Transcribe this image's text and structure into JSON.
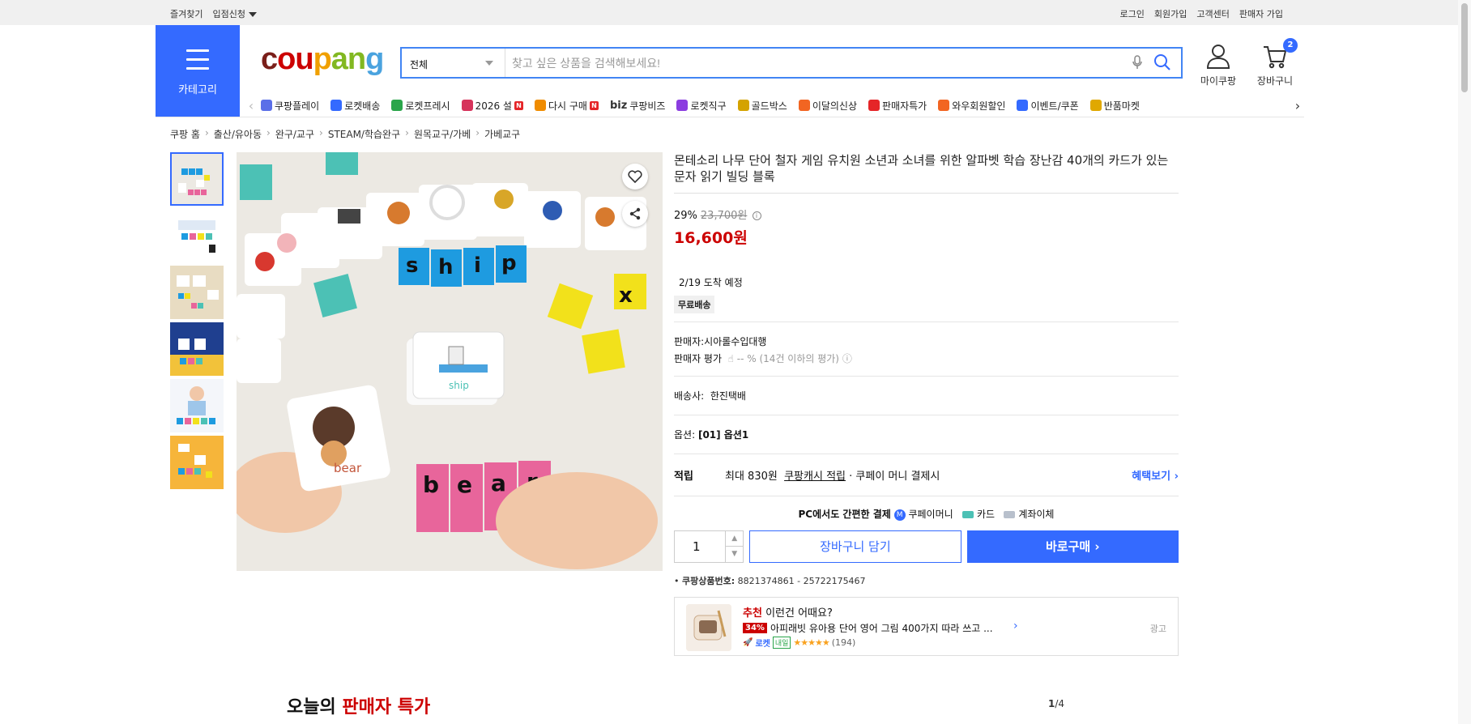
{
  "topbar": {
    "bookmark": "즐겨찾기",
    "vendor_apply": "입점신청",
    "login": "로그인",
    "signup": "회원가입",
    "cs": "고객센터",
    "seller_signup": "판매자 가입"
  },
  "header": {
    "category_label": "카테고리",
    "logo_parts": [
      "c",
      "ou",
      "p",
      "an",
      "g"
    ],
    "search_category": "전체",
    "search_placeholder": "찾고 싶은 상품을 검색해보세요!",
    "mycoupang": "마이쿠팡",
    "cart_label": "장바구니",
    "cart_count": "2"
  },
  "gnb": [
    {
      "label": "쿠팡플레이",
      "icon": "play-icon",
      "color": "#5b6fe8"
    },
    {
      "label": "로켓배송",
      "icon": "rocket-icon",
      "color": "#346aff"
    },
    {
      "label": "로켓프레시",
      "icon": "rocket-fresh-icon",
      "color": "#2aa54a"
    },
    {
      "label": "2026 설",
      "icon": "gift-icon",
      "color": "#d6335b",
      "badge": "N"
    },
    {
      "label": "다시 구매",
      "icon": "rebuy-icon",
      "color": "#f08c00",
      "badge": "N"
    },
    {
      "label": "쿠팡비즈",
      "icon": "biz-icon",
      "color": "#333",
      "prefix": "biz"
    },
    {
      "label": "로켓직구",
      "icon": "global-icon",
      "color": "#8b3de0"
    },
    {
      "label": "골드박스",
      "icon": "goldbox-icon",
      "color": "#d4a300"
    },
    {
      "label": "이달의신상",
      "icon": "new-bag-icon",
      "color": "#f26522"
    },
    {
      "label": "판매자특가",
      "icon": "percent-icon",
      "color": "#e52528"
    },
    {
      "label": "와우회원할인",
      "icon": "wow-icon",
      "color": "#f26522"
    },
    {
      "label": "이벤트/쿠폰",
      "icon": "coupon-icon",
      "color": "#346aff"
    },
    {
      "label": "반품마켓",
      "icon": "return-market-icon",
      "color": "#e0a800"
    }
  ],
  "breadcrumb": [
    "쿠팡 홈",
    "출산/유아동",
    "완구/교구",
    "STEAM/학습완구",
    "원목교구/가베",
    "가베교구"
  ],
  "product": {
    "title": "몬테소리 나무 단어 철자 게임 유치원 소년과 소녀를 위한 알파벳 학습 장난감 40개의 카드가 있는 문자 읽기 빌딩 블록",
    "discount_pct": "29%",
    "orig_price": "23,700원",
    "sale_price": "16,600원",
    "arrival": "2/19 도착 예정",
    "free_ship": "무료배송",
    "seller_label": "판매자:",
    "seller_name": "시아롤수입대행",
    "seller_rating_label": "판매자 평가",
    "seller_rating_value": "-- % (14건 이하의 평가)",
    "ship_label": "배송사:",
    "ship_company": "한진택배",
    "option_label": "옵션:",
    "option_value": "[01] 옵션1",
    "reward_label": "적립",
    "reward_text1": "최대 830원",
    "reward_link": "쿠팡캐시 적립",
    "reward_text2": "· 쿠페이 머니 결제시",
    "reward_more": "혜택보기",
    "pay_title": "PC에서도 간편한 결제",
    "pay_money": "쿠페이머니",
    "pay_card": "카드",
    "pay_bank": "계좌이체",
    "qty": "1",
    "add_cart": "장바구니 담기",
    "buy_now": "바로구매",
    "product_no_label": "쿠팡상품번호:",
    "product_no": "8821374861 - 25722175467"
  },
  "recommend": {
    "title_red": "추천",
    "title_rest": "이런건 어때요?",
    "discount": "34%",
    "name": "아피래빗 유아용 단어 영어 그림 400가지 따라 쓰고 ...",
    "rocket": "로켓",
    "next_day": "내일",
    "rating": 5,
    "reviews": "(194)",
    "ad": "광고"
  },
  "section": {
    "title_a": "오늘의",
    "title_b": "판매자 특가",
    "page_cur": "1",
    "page_total": "/4"
  }
}
